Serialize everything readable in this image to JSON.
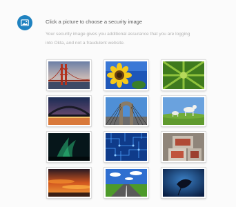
{
  "heading": "Click a picture to choose a security image",
  "description_lines": [
    "Your security image gives you additional assurance that you are logging",
    "into Okta, and not a fraudulent website."
  ],
  "step_icon": "picture-icon",
  "accent_color": "#1f82c0",
  "images": [
    {
      "name": "golden-gate-bridge-image"
    },
    {
      "name": "sunflower-image"
    },
    {
      "name": "green-leaf-image"
    },
    {
      "name": "bridge-at-night-image"
    },
    {
      "name": "brooklyn-bridge-image"
    },
    {
      "name": "goats-on-hill-image"
    },
    {
      "name": "aurora-image"
    },
    {
      "name": "circuit-board-image"
    },
    {
      "name": "letter-blocks-image"
    },
    {
      "name": "sunset-clouds-image"
    },
    {
      "name": "country-road-image"
    },
    {
      "name": "stingray-image"
    }
  ]
}
